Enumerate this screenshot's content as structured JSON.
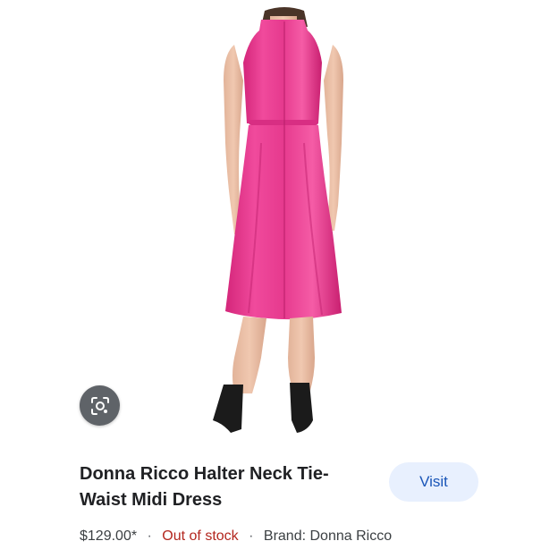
{
  "product": {
    "title_line1": "Donna Ricco Halter Neck Tie-",
    "title_line2": "Waist Midi Dress",
    "price": "$129.00*",
    "stock_status": "Out of stock",
    "brand": "Brand: Donna Ricco",
    "separator": "·"
  },
  "actions": {
    "visit_label": "Visit",
    "lens_icon": "lens-search-icon"
  },
  "colors": {
    "dress_pink": "#e8388c",
    "stock_red": "#b3261e",
    "visit_bg": "#e8f0fe",
    "visit_text": "#1a56b8",
    "lens_bg": "#5f6368"
  }
}
